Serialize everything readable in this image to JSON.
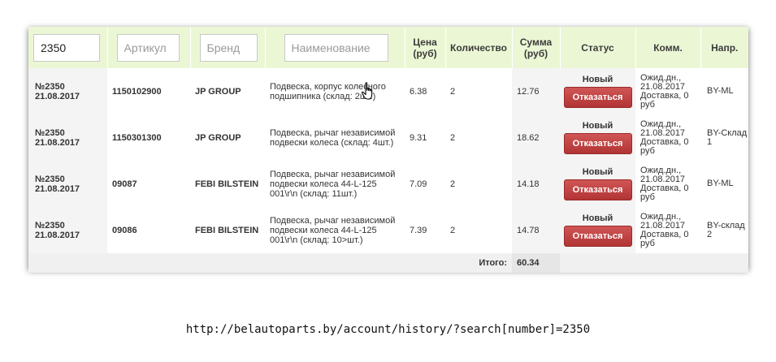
{
  "filters": {
    "number_value": "2350",
    "article_placeholder": "Артикул",
    "brand_placeholder": "Бренд",
    "name_placeholder": "Наименование"
  },
  "headers": {
    "price": "Цена (руб)",
    "qty": "Количество",
    "sum": "Сумма (руб)",
    "status": "Статус",
    "comm": "Комм.",
    "dir": "Напр."
  },
  "rows": [
    {
      "number": "№2350",
      "date": "21.08.2017",
      "article": "1150102900",
      "brand": "JP GROUP",
      "name": "Подвеска, корпус колесного подшипника (склад: 2шт.)",
      "price": "6.38",
      "qty": "2",
      "sum": "12.76",
      "status": "Новый",
      "cancel": "Отказаться",
      "comment": "Ожид.дн., 21.08.2017 Доставка, 0 руб",
      "direction": "BY-ML"
    },
    {
      "number": "№2350",
      "date": "21.08.2017",
      "article": "1150301300",
      "brand": "JP GROUP",
      "name": "Подвеска, рычаг независимой подвески колеса (склад: 4шт.)",
      "price": "9.31",
      "qty": "2",
      "sum": "18.62",
      "status": "Новый",
      "cancel": "Отказаться",
      "comment": "Ожид.дн., 21.08.2017 Доставка, 0 руб",
      "direction": "BY-Склад 1"
    },
    {
      "number": "№2350",
      "date": "21.08.2017",
      "article": "09087",
      "brand": "FEBI BILSTEIN",
      "name": "Подвеска, рычаг независимой подвески колеса 44-L-125 001\\r\\n (склад: 11шт.)",
      "price": "7.09",
      "qty": "2",
      "sum": "14.18",
      "status": "Новый",
      "cancel": "Отказаться",
      "comment": "Ожид.дн., 21.08.2017 Доставка, 0 руб",
      "direction": "BY-ML"
    },
    {
      "number": "№2350",
      "date": "21.08.2017",
      "article": "09086",
      "brand": "FEBI BILSTEIN",
      "name": "Подвеска, рычаг независимой подвески колеса 44-L-125 001\\r\\n (склад: 10>шт.)",
      "price": "7.39",
      "qty": "2",
      "sum": "14.78",
      "status": "Новый",
      "cancel": "Отказаться",
      "comment": "Ожид.дн., 21.08.2017 Доставка, 0 руб",
      "direction": "BY-склад 2"
    }
  ],
  "footer": {
    "total_label": "Итого:",
    "total_value": "60.34"
  },
  "url": "http://belautoparts.by/account/history/?search[number]=2350",
  "icons": {
    "cursor": "hand-pointer-icon"
  },
  "colors": {
    "header_bg": "#ebf7d4",
    "cancel_button": "#c04545"
  }
}
